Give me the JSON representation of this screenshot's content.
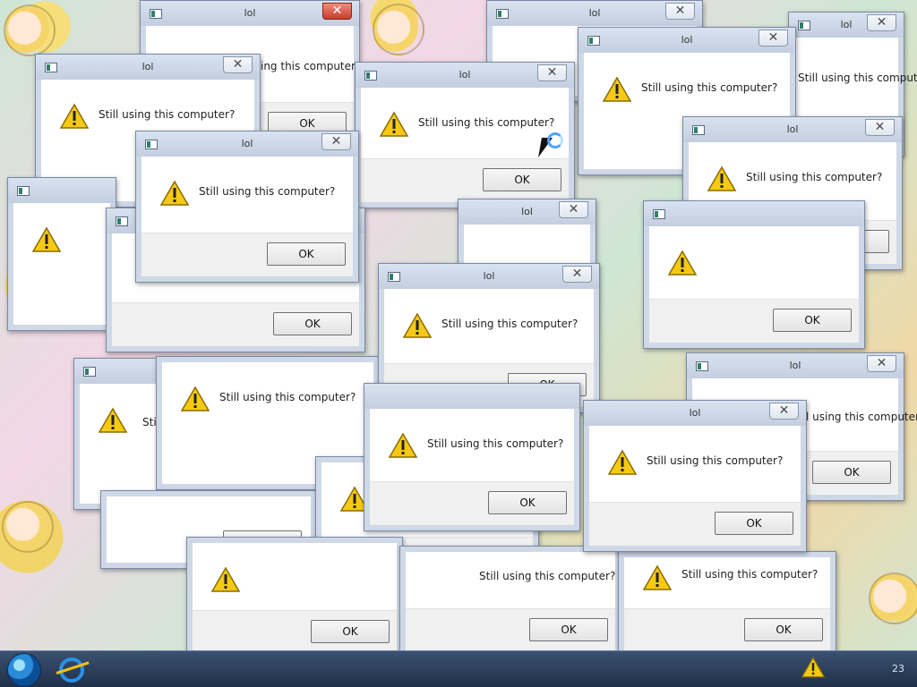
{
  "dialog": {
    "title": "lol",
    "message": "Still using this computer?",
    "button": "OK",
    "mirrored_message": "Still using this computer?",
    "mirrored_button": "OK"
  },
  "taskbar": {
    "clock": "23"
  },
  "icons": {
    "window_icon": "app-window-icon",
    "warning": "warning-icon",
    "close": "close-icon",
    "start": "windows-start-icon",
    "browser": "internet-explorer-icon"
  },
  "colors": {
    "dialog_frame": "#cfd8e6",
    "button_border": "#707070",
    "warning_yellow": "#f4c20d"
  }
}
